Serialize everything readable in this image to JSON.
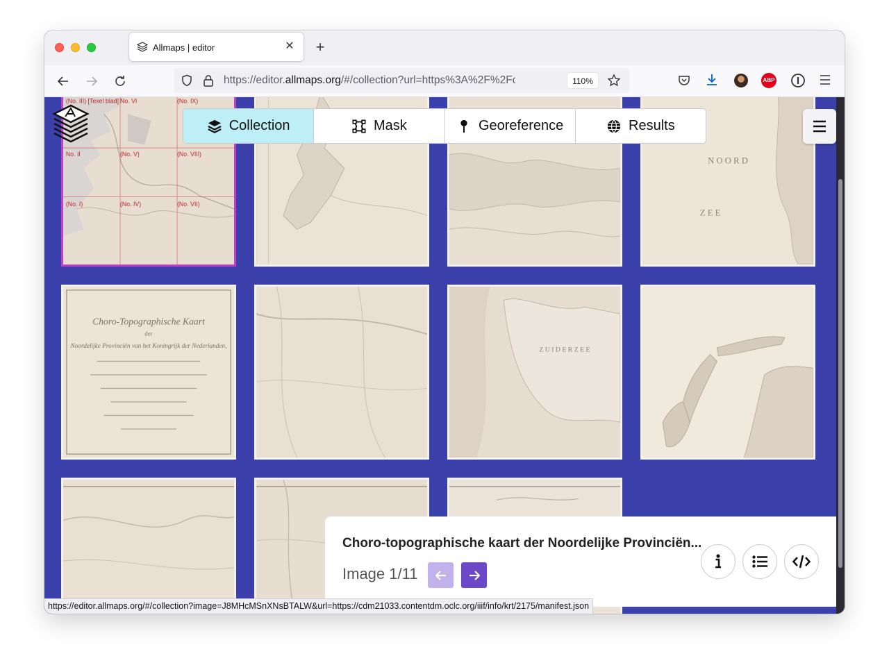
{
  "browser": {
    "tab_title": "Allmaps | editor",
    "url_prefix": "https://editor.",
    "url_domain": "allmaps.org",
    "url_rest": "/#/collection?url=https%3A%2F%2Fcdm2",
    "zoom": "110%",
    "status_url": "https://editor.allmaps.org/#/collection?image=J8MHcMSnXNsBTALW&url=https://cdm21033.contentdm.oclc.org/iiif/info/krt/2175/manifest.json"
  },
  "app": {
    "steps": [
      {
        "label": "Collection",
        "icon": "layers-icon"
      },
      {
        "label": "Mask",
        "icon": "mask-icon"
      },
      {
        "label": "Georeference",
        "icon": "pin-icon"
      },
      {
        "label": "Results",
        "icon": "globe-icon"
      }
    ],
    "active_step": "Collection",
    "map_labels": {
      "index": [
        "(No. III) [Texel blad]",
        "No. VI",
        "(No. IX)",
        "No. II",
        "(No. V)",
        "(No. VIII)",
        "(No. I)",
        "(No. IV)",
        "(No. VII)"
      ],
      "noordzee_top": "N O O R D",
      "noordzee_bottom": "Z E E",
      "title_line1": "Choro-Topographische Kaart",
      "title_line2": "der",
      "title_line3": "Noordelijke Provinciën van het Koningrijk der Nederlanden,",
      "zuiderzee": "Z U I D E R Z E E"
    }
  },
  "panel": {
    "title": "Choro-topographische kaart der Noordelijke Provinciën...",
    "image_label": "Image 1/11"
  },
  "colors": {
    "page_bg": "#3b40aa",
    "active_step": "#bfeff6",
    "selected_border": "#c23ec6",
    "next_button": "#6c47c8",
    "prev_button": "#c2b2ec"
  }
}
